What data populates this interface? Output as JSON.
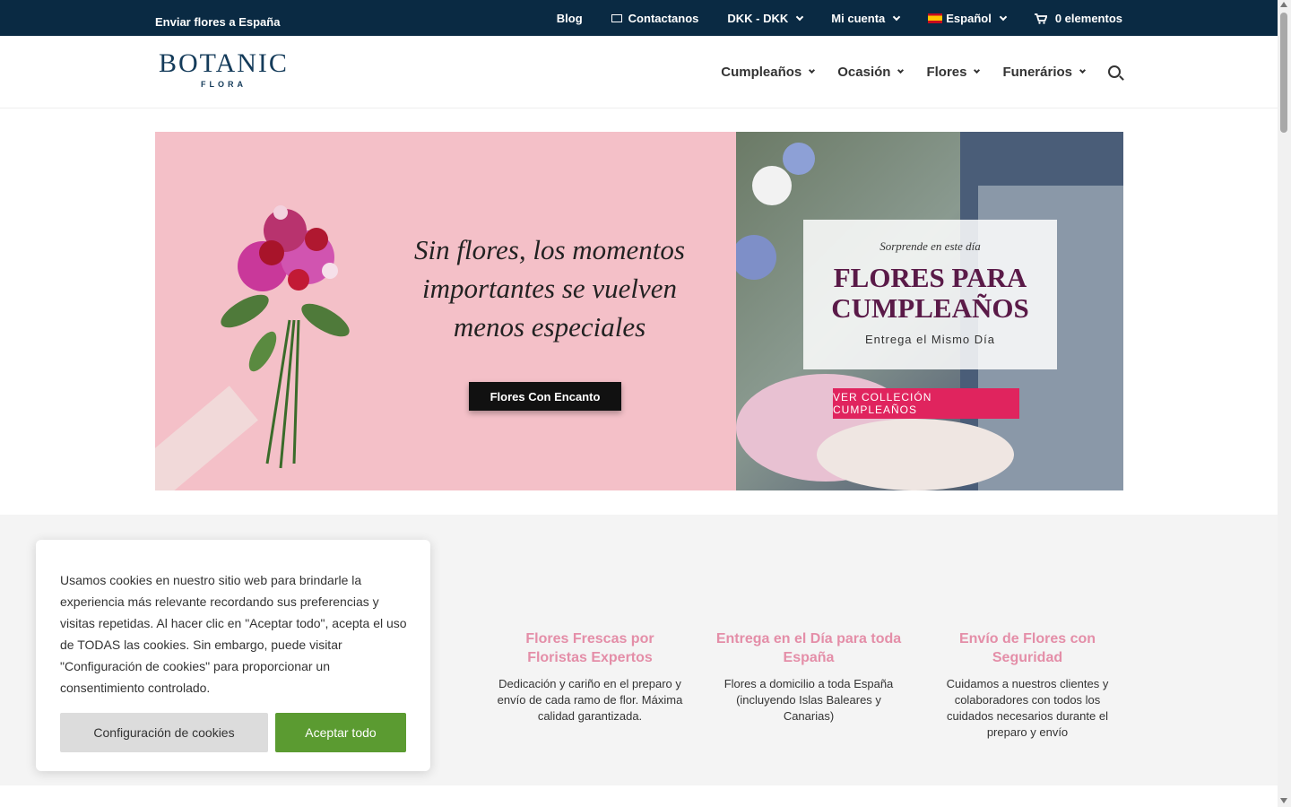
{
  "topbar": {
    "ship": "Enviar flores a España",
    "blog": "Blog",
    "contact": "Contactanos",
    "currency": "DKK - DKK",
    "account": "Mi cuenta",
    "language": "Español",
    "cart": "0 elementos"
  },
  "logo": {
    "brand": "BOTANIC",
    "sub": "FLORA"
  },
  "nav": {
    "items": [
      "Cumpleaños",
      "Ocasión",
      "Flores",
      "Funerários"
    ]
  },
  "hero_left": {
    "line1": "Sin flores, los momentos",
    "line2": "importantes se vuelven",
    "line3": "menos especiales",
    "button": "Flores Con Encanto"
  },
  "hero_right": {
    "kicker": "Sorprende en este día",
    "title1": "FLORES PARA",
    "title2": "CUMPLEAÑOS",
    "subtitle": "Entrega el Mismo Día",
    "button": "VER COLLECIÓN CUMPLEAÑOS"
  },
  "features": [
    {
      "title": "Flores Frescas por Floristas Expertos",
      "text": "Dedicación y cariño en el preparo y envío de cada ramo de flor. Máxima calidad garantizada."
    },
    {
      "title": "Entrega en el Día para toda España",
      "text": "Flores a domicilio a toda España (incluyendo Islas Baleares y Canarias)"
    },
    {
      "title": "Envío de Flores con Seguridad",
      "text": "Cuidamos a nuestros clientes y colaboradores con todos los cuidados necesarios durante el preparo y envío"
    }
  ],
  "cookie": {
    "text": "Usamos cookies en nuestro sitio web para brindarle la experiencia más relevante recordando sus preferencias y visitas repetidas. Al hacer clic en \"Aceptar todo\", acepta el uso de TODAS las cookies. Sin embargo, puede visitar \"Configuración de cookies\" para proporcionar un consentimiento controlado.",
    "settings": "Configuración de cookies",
    "accept": "Aceptar todo"
  },
  "colors": {
    "topbar": "#0a2a43",
    "accent_pink": "#e0245e",
    "feature_title": "#e48ea8",
    "accept_green": "#5b9b31"
  }
}
